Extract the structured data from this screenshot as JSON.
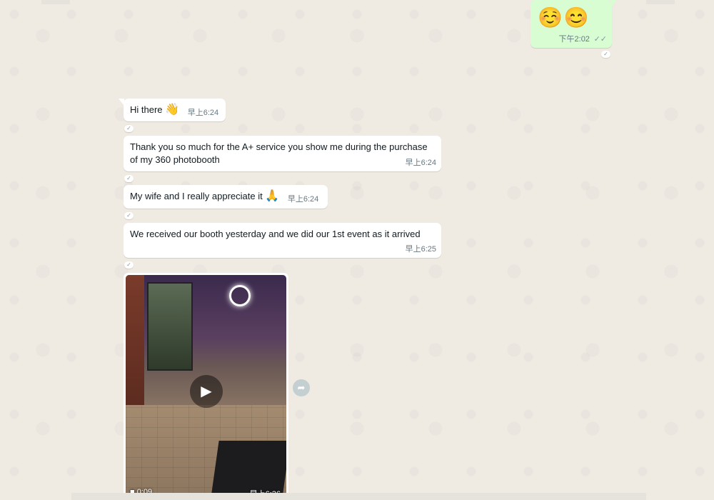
{
  "outgoing": {
    "emoji": "☺️😊",
    "time": "下午2:02",
    "status": "✓✓"
  },
  "messages": [
    {
      "text": "Hi there",
      "emoji": "👋",
      "time": "早上6:24"
    },
    {
      "text": "Thank you so much for the A+ service you show me during the purchase of my 360 photobooth",
      "time": "早上6:24"
    },
    {
      "text": "My wife and I really appreciate it",
      "emoji": "🙏",
      "time": "早上6:24"
    },
    {
      "text": "We received our booth yesterday and we did our 1st event as it arrived",
      "time": "早上6:25"
    }
  ],
  "video": {
    "duration": "0:09",
    "time": "早上6:26"
  },
  "icons": {
    "play": "play-icon",
    "forward": "forward-icon",
    "video": "video-camera-icon",
    "reaction": "reaction-check-icon"
  }
}
